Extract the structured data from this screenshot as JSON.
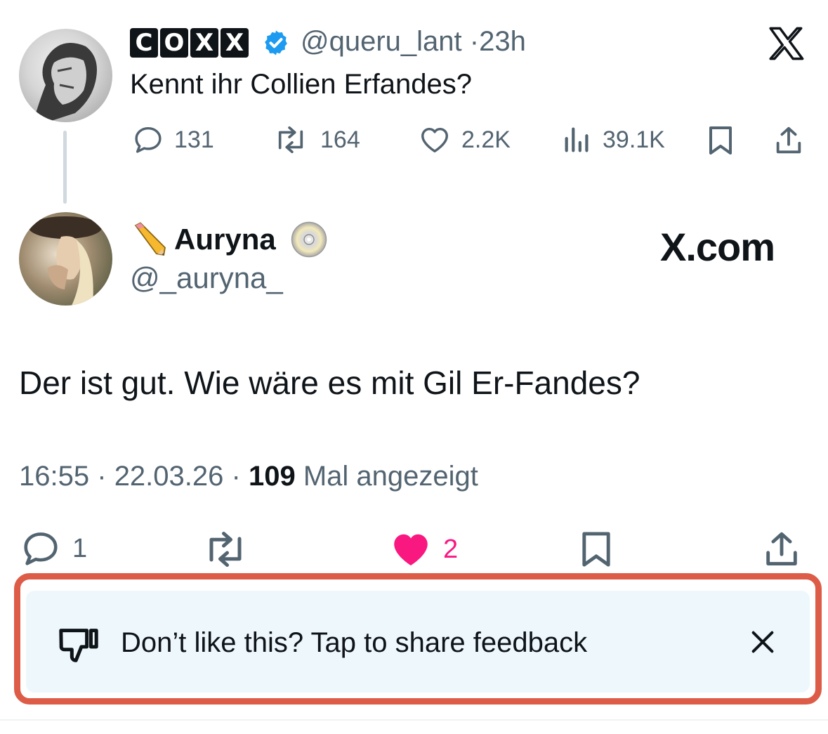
{
  "tweet": {
    "author_logo_letters": [
      "C",
      "O",
      "X",
      "X"
    ],
    "handle": "@queru_lant",
    "separator": "·",
    "time_ago": "23h",
    "text": "Kennt ihr Collien Erfandes?",
    "stats": {
      "replies": "131",
      "reposts": "164",
      "likes": "2.2K",
      "views": "39.1K"
    }
  },
  "reply": {
    "display_name": "Auryna",
    "handle": "@_auryna_",
    "source_watermark": "X.com",
    "text": "Der ist gut. Wie wäre es mit Gil Er-Fandes?",
    "time": "16:55",
    "date": "22.03.26",
    "sep": "·",
    "views_count": "109",
    "views_label": "Mal angezeigt",
    "stats": {
      "replies": "1",
      "likes": "2"
    },
    "liked_color": "#f91880"
  },
  "feedback": {
    "text": "Don’t like this? Tap to share feedback"
  },
  "colors": {
    "verified": "#1d9bf0",
    "muted": "#536471",
    "highlight_border": "#dd5c48",
    "banner_bg": "#eef8fc"
  }
}
